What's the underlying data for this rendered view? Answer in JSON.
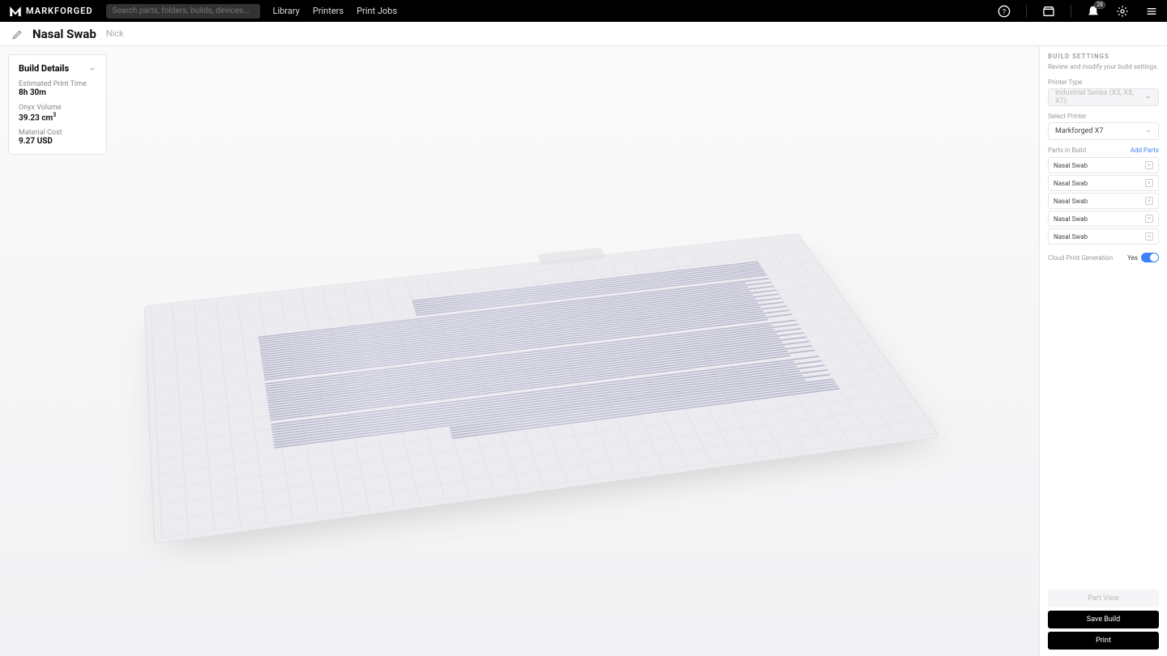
{
  "nav": {
    "brand": "MARKFORGED",
    "search_placeholder": "Search parts, folders, builds, devices...",
    "links": [
      "Library",
      "Printers",
      "Print Jobs"
    ],
    "notification_count": "28"
  },
  "titlebar": {
    "build_name": "Nasal Swab",
    "author": "Nick"
  },
  "details": {
    "heading": "Build Details",
    "rows": [
      {
        "label": "Estimated Print Time",
        "value": "8h 30m"
      },
      {
        "label": "Onyx Volume",
        "value": "39.23 cm",
        "sup": "3"
      },
      {
        "label": "Material Cost",
        "value": "9.27 USD"
      }
    ]
  },
  "settings": {
    "title": "BUILD SETTINGS",
    "sub": "Review and modify your build settings.",
    "printer_type_label": "Printer Type",
    "printer_type_value": "Industrial Series (X3, X5, X7)",
    "select_printer_label": "Select Printer",
    "select_printer_value": "Markforged X7",
    "parts_label": "Parts in Build",
    "add_parts": "Add Parts",
    "parts": [
      "Nasal Swab",
      "Nasal Swab",
      "Nasal Swab",
      "Nasal Swab",
      "Nasal Swab"
    ],
    "cloud_label": "Cloud Print Generation",
    "cloud_value": "Yes",
    "buttons": {
      "part_view": "Part View",
      "save_build": "Save Build",
      "print": "Print"
    }
  }
}
